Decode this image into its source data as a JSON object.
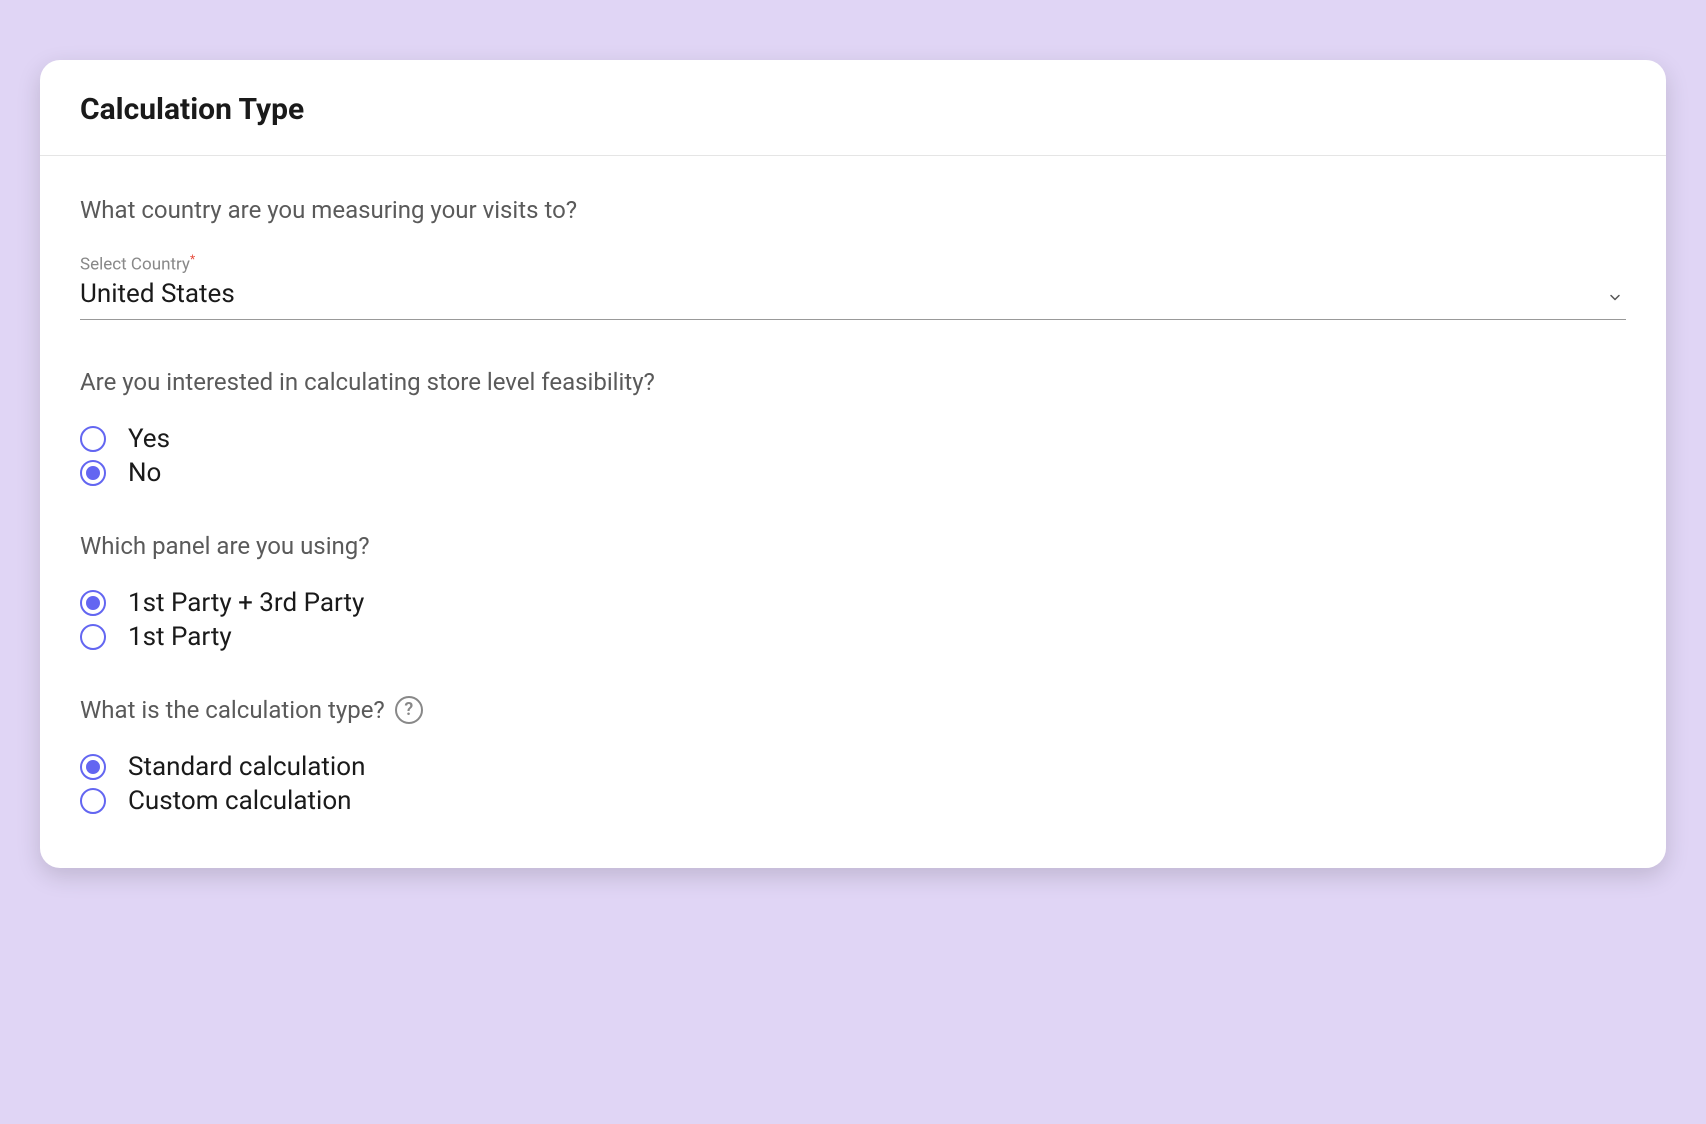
{
  "card": {
    "title": "Calculation Type"
  },
  "country": {
    "question": "What country are you measuring your visits to?",
    "field_label": "Select Country",
    "value": "United States"
  },
  "feasibility": {
    "question": "Are you interested in calculating store level feasibility?",
    "options": [
      {
        "label": "Yes",
        "checked": false
      },
      {
        "label": "No",
        "checked": true
      }
    ]
  },
  "panel": {
    "question": "Which panel are you using?",
    "options": [
      {
        "label": "1st Party + 3rd Party",
        "checked": true
      },
      {
        "label": "1st Party",
        "checked": false
      }
    ]
  },
  "calc_type": {
    "question": "What is the calculation type?",
    "options": [
      {
        "label": "Standard calculation",
        "checked": true
      },
      {
        "label": "Custom calculation",
        "checked": false
      }
    ]
  }
}
